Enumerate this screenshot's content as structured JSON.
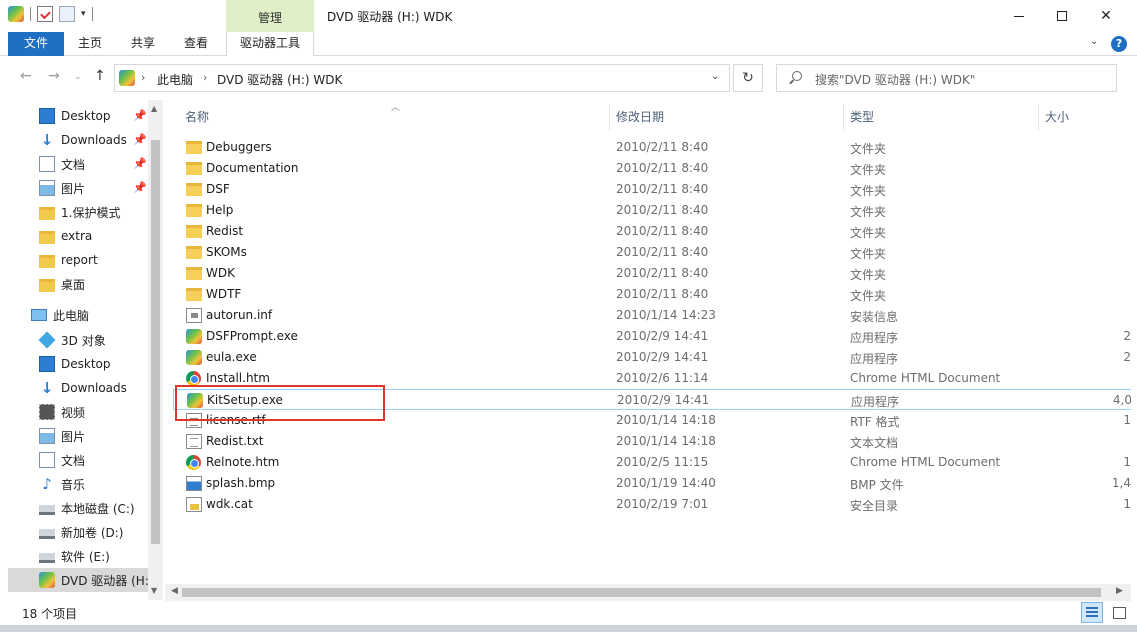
{
  "window": {
    "title": "DVD 驱动器 (H:) WDK",
    "manage_tab": "管理",
    "quick_access": {
      "customize": "▾"
    }
  },
  "ribbon": {
    "tabs": [
      "文件",
      "主页",
      "共享",
      "查看",
      "驱动器工具"
    ],
    "expand": "⌄",
    "help": "?"
  },
  "nav": {
    "back": "←",
    "forward": "→",
    "history": "⌄",
    "up": "↑",
    "address": {
      "crumbs": [
        "此电脑",
        "DVD 驱动器 (H:) WDK"
      ],
      "separator": "›",
      "dropdown": "⌄"
    },
    "refresh": "↻",
    "search_placeholder": "搜索\"DVD 驱动器 (H:) WDK\""
  },
  "sidebar": {
    "quick_access": [
      {
        "label": "Desktop",
        "icon": "desktop-icon",
        "pinned": true
      },
      {
        "label": "Downloads",
        "icon": "download-icon",
        "pinned": true
      },
      {
        "label": "文档",
        "icon": "document-icon",
        "pinned": true
      },
      {
        "label": "图片",
        "icon": "picture-icon",
        "pinned": true
      },
      {
        "label": "1.保护模式",
        "icon": "folder-icon"
      },
      {
        "label": "extra",
        "icon": "folder-icon"
      },
      {
        "label": "report",
        "icon": "folder-icon"
      },
      {
        "label": "桌面",
        "icon": "folder-icon"
      }
    ],
    "this_pc": {
      "label": "此电脑",
      "icon": "computer-icon"
    },
    "pc_items": [
      {
        "label": "3D 对象",
        "icon": "3d-objects-icon"
      },
      {
        "label": "Desktop",
        "icon": "desktop-icon"
      },
      {
        "label": "Downloads",
        "icon": "download-icon"
      },
      {
        "label": "视频",
        "icon": "video-icon"
      },
      {
        "label": "图片",
        "icon": "picture-icon"
      },
      {
        "label": "文档",
        "icon": "document-icon"
      },
      {
        "label": "音乐",
        "icon": "music-icon"
      },
      {
        "label": "本地磁盘 (C:)",
        "icon": "drive-icon"
      },
      {
        "label": "新加卷 (D:)",
        "icon": "drive-icon"
      },
      {
        "label": "软件 (E:)",
        "icon": "drive-icon"
      },
      {
        "label": "DVD 驱动器 (H:",
        "icon": "dvd-drive-icon",
        "selected": true
      }
    ],
    "pin_glyph": "📌"
  },
  "columns": {
    "name": "名称",
    "date": "修改日期",
    "type": "类型",
    "size": "大小"
  },
  "files": [
    {
      "name": "Debuggers",
      "date": "2010/2/11 8:40",
      "type": "文件夹",
      "size": "",
      "icon": "folder-icon"
    },
    {
      "name": "Documentation",
      "date": "2010/2/11 8:40",
      "type": "文件夹",
      "size": "",
      "icon": "folder-icon"
    },
    {
      "name": "DSF",
      "date": "2010/2/11 8:40",
      "type": "文件夹",
      "size": "",
      "icon": "folder-icon"
    },
    {
      "name": "Help",
      "date": "2010/2/11 8:40",
      "type": "文件夹",
      "size": "",
      "icon": "folder-icon"
    },
    {
      "name": "Redist",
      "date": "2010/2/11 8:40",
      "type": "文件夹",
      "size": "",
      "icon": "folder-icon"
    },
    {
      "name": "SKOMs",
      "date": "2010/2/11 8:40",
      "type": "文件夹",
      "size": "",
      "icon": "folder-icon"
    },
    {
      "name": "WDK",
      "date": "2010/2/11 8:40",
      "type": "文件夹",
      "size": "",
      "icon": "folder-icon"
    },
    {
      "name": "WDTF",
      "date": "2010/2/11 8:40",
      "type": "文件夹",
      "size": "",
      "icon": "folder-icon"
    },
    {
      "name": "autorun.inf",
      "date": "2010/1/14 14:23",
      "type": "安装信息",
      "size": "",
      "icon": "inf-file-icon"
    },
    {
      "name": "DSFPrompt.exe",
      "date": "2010/2/9 14:41",
      "type": "应用程序",
      "size": "2",
      "icon": "exe-file-icon"
    },
    {
      "name": "eula.exe",
      "date": "2010/2/9 14:41",
      "type": "应用程序",
      "size": "2",
      "icon": "exe-file-icon"
    },
    {
      "name": "Install.htm",
      "date": "2010/2/6 11:14",
      "type": "Chrome HTML Document",
      "size": "",
      "icon": "chrome-html-icon"
    },
    {
      "name": "KitSetup.exe",
      "date": "2010/2/9 14:41",
      "type": "应用程序",
      "size": "4,0",
      "icon": "exe-file-icon",
      "selected": true
    },
    {
      "name": "license.rtf",
      "date": "2010/1/14 14:18",
      "type": "RTF 格式",
      "size": "1",
      "icon": "rtf-file-icon"
    },
    {
      "name": "Redist.txt",
      "date": "2010/1/14 14:18",
      "type": "文本文档",
      "size": "",
      "icon": "text-file-icon"
    },
    {
      "name": "Relnote.htm",
      "date": "2010/2/5 11:15",
      "type": "Chrome HTML Document",
      "size": "1",
      "icon": "chrome-html-icon"
    },
    {
      "name": "splash.bmp",
      "date": "2010/1/19 14:40",
      "type": "BMP 文件",
      "size": "1,4",
      "icon": "bitmap-file-icon"
    },
    {
      "name": "wdk.cat",
      "date": "2010/2/19 7:01",
      "type": "安全目录",
      "size": "1",
      "icon": "catalog-file-icon"
    }
  ],
  "status": {
    "count": "18 个项目"
  },
  "colors": {
    "accent": "#1f6fc5",
    "manage_tab_bg": "#dff0c8",
    "selection_border": "#99d1ff",
    "highlight_box": "#e0352b"
  }
}
